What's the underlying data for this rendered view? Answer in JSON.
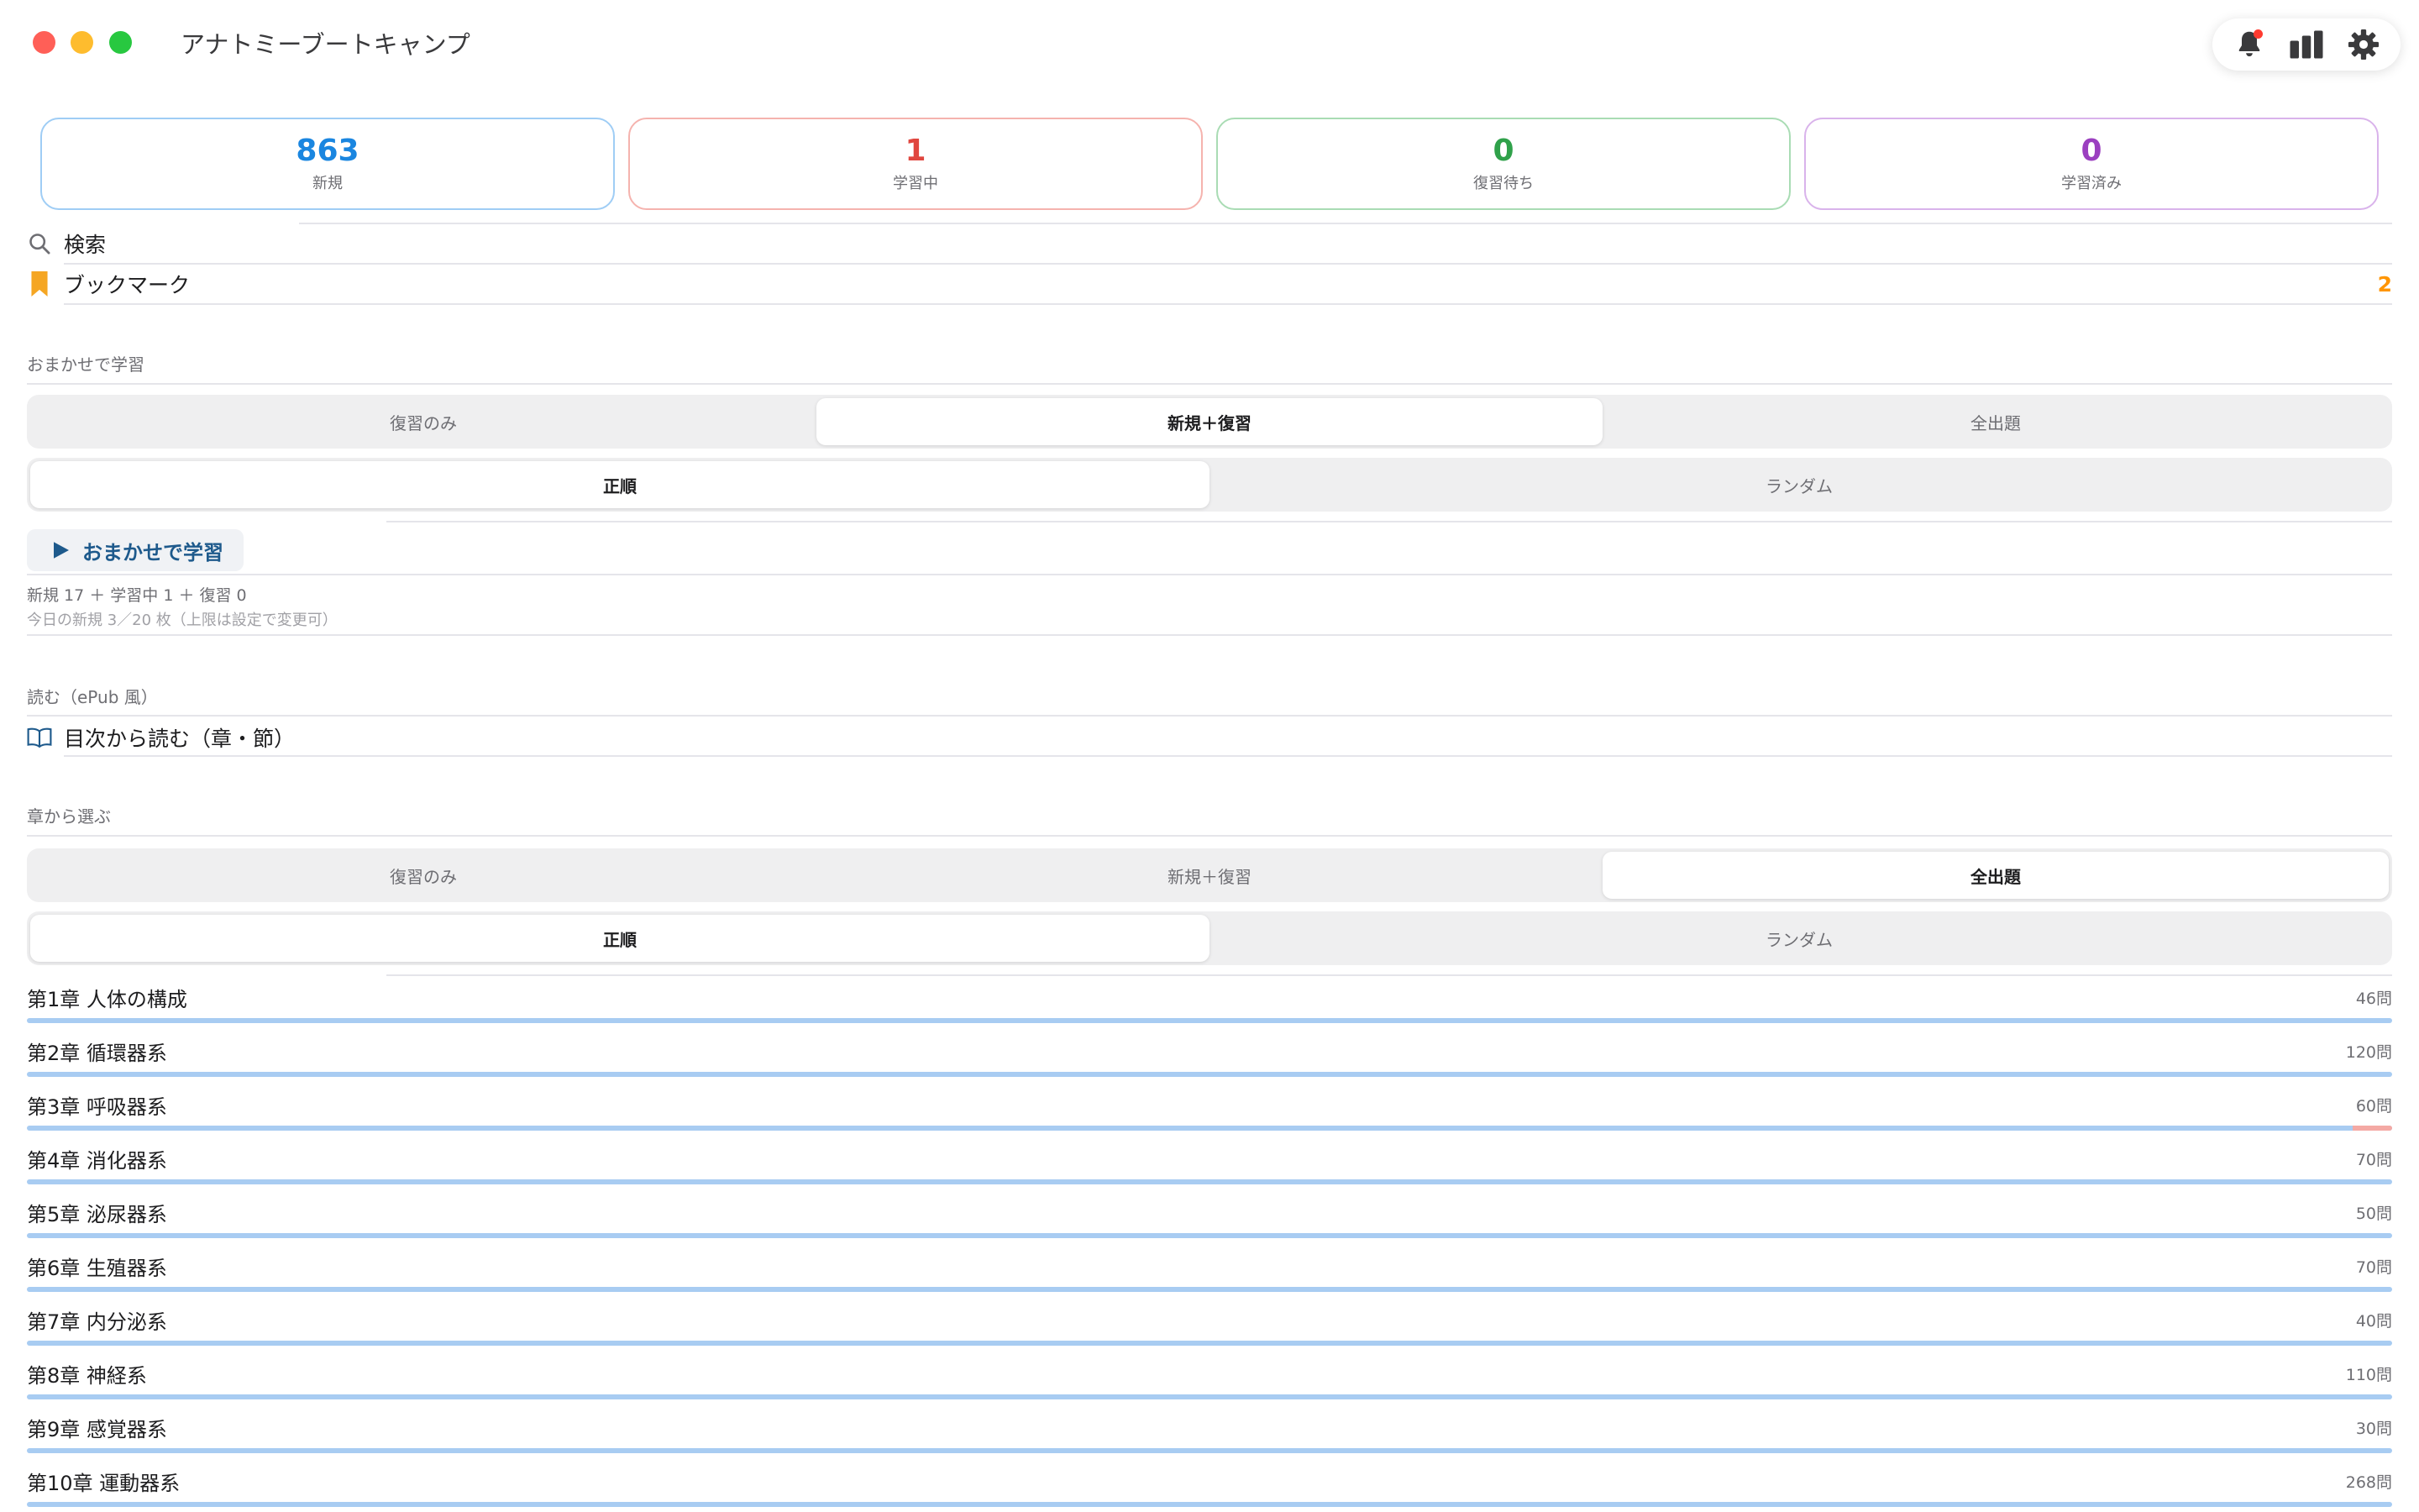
{
  "app": {
    "title": "アナトミーブートキャンプ"
  },
  "toolbar": {
    "icons": [
      "bell-icon",
      "chart-bar-icon",
      "gear-icon"
    ]
  },
  "stats": [
    {
      "value": "863",
      "label": "新規",
      "color": "#1a86e0",
      "border": "#9fcdf5"
    },
    {
      "value": "1",
      "label": "学習中",
      "color": "#e0463f",
      "border": "#f5b3ae"
    },
    {
      "value": "0",
      "label": "復習待ち",
      "color": "#2fa14a",
      "border": "#a9dcb4"
    },
    {
      "value": "0",
      "label": "学習済み",
      "color": "#9b3fc0",
      "border": "#d9b3eb"
    }
  ],
  "search": {
    "label": "検索"
  },
  "bookmark": {
    "label": "ブックマーク",
    "count": "2"
  },
  "auto_study": {
    "header": "おまかせで学習",
    "mode_options": [
      "復習のみ",
      "新規＋復習",
      "全出題"
    ],
    "mode_selected": "新規＋復習",
    "order_options": [
      "正順",
      "ランダム"
    ],
    "order_selected": "正順",
    "button_label": "おまかせで学習",
    "summary": "新規 17 ＋ 学習中 1 ＋ 復習 0",
    "daily_note": "今日の新規 3／20 枚（上限は設定で変更可）"
  },
  "read": {
    "header": "読む（ePub 風）",
    "toc_label": "目次から読む（章・節）"
  },
  "chapter_select": {
    "header": "章から選ぶ",
    "mode_options": [
      "復習のみ",
      "新規＋復習",
      "全出題"
    ],
    "mode_selected": "全出題",
    "order_options": [
      "正順",
      "ランダム"
    ],
    "order_selected": "正順"
  },
  "chapters": [
    {
      "name": "第1章 人体の構成",
      "count": "46問",
      "learning": 0
    },
    {
      "name": "第2章 循環器系",
      "count": "120問",
      "learning": 0
    },
    {
      "name": "第3章 呼吸器系",
      "count": "60問",
      "learning": 1
    },
    {
      "name": "第4章 消化器系",
      "count": "70問",
      "learning": 0
    },
    {
      "name": "第5章 泌尿器系",
      "count": "50問",
      "learning": 0
    },
    {
      "name": "第6章 生殖器系",
      "count": "70問",
      "learning": 0
    },
    {
      "name": "第7章 内分泌系",
      "count": "40問",
      "learning": 0
    },
    {
      "name": "第8章 神経系",
      "count": "110問",
      "learning": 0
    },
    {
      "name": "第9章 感覚器系",
      "count": "30問",
      "learning": 0
    },
    {
      "name": "第10章 運動器系",
      "count": "268問",
      "learning": 0
    }
  ]
}
